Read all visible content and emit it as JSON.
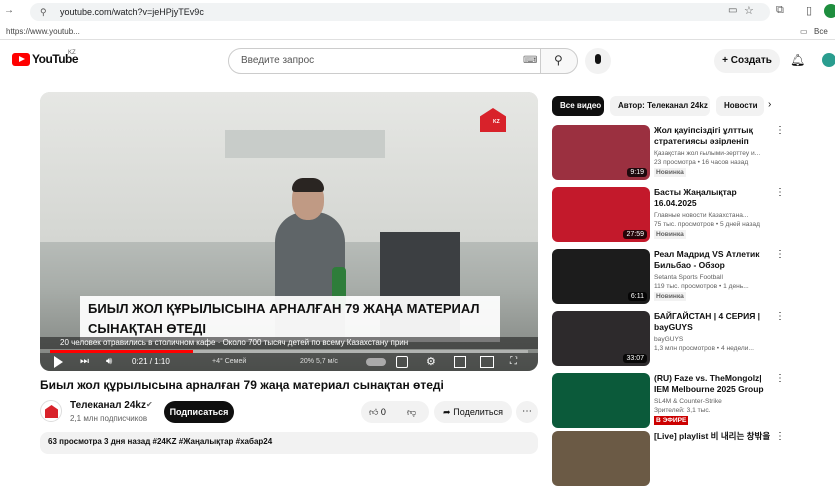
{
  "browser": {
    "url": "youtube.com/watch?v=jeHPjyTEv9c",
    "bookmark": "https://www.youtub...",
    "bookmarks_all": "Все за"
  },
  "header": {
    "logo": "YouTube",
    "region": "KZ",
    "search_placeholder": "Введите запрос",
    "create_label": "Создать"
  },
  "player": {
    "channel_logo": "KZ",
    "lower_third": "БИЫЛ ЖОЛ ҚҰРЫЛЫСЫНА АРНАЛҒАН 79 ЖАҢА МАТЕРИАЛ СЫНАҚТАН ӨТЕДІ",
    "ticker": "20 человек отравились в столичном кафе   ·   Около 700 тысяч детей по всему Казахстану прин",
    "weather_left": "+4°  Семей",
    "weather_right": "20%  5,7 м/с",
    "time": "0:21 / 1:10",
    "progress": 0.3
  },
  "video": {
    "title": "Биыл жол құрылысына арналған 79 жаңа материал сынақтан өтеді",
    "channel": "Телеканал 24kz",
    "subscribers": "2,1 млн подписчиков",
    "subscribe_label": "Подписаться",
    "likes": "0",
    "share_label": "Поделиться",
    "description": "63 просмотра  3 дня назад  #24KZ #Жаңалықтар #хабар24"
  },
  "chips": [
    "Все видео",
    "Автор: Телеканал 24kz",
    "Новости"
  ],
  "recommendations": [
    {
      "title": "Жол қауіпсіздігі ұлттық стратегиясы әзірленіп жатыр",
      "channel": "Қазақстан жол ғылыми-зерттеу и...",
      "meta": "23 просмотра • 16 часов назад",
      "badge": "Новинка",
      "duration": "9:19",
      "thumb": "#9b3040"
    },
    {
      "title": "Басты Жаңалықтар 16.04.2025",
      "channel": "Главные новости Казахстана...",
      "meta": "75 тыс. просмотров • 5 дней назад",
      "badge": "Новинка",
      "duration": "27:59",
      "thumb": "#c3192b"
    },
    {
      "title": "Реал Мадрид VS Атлетик Бильбао - Обзор",
      "channel": "Setanta Sports Football",
      "meta": "119 тыс. просмотров • 1 день...",
      "badge": "Новинка",
      "duration": "6:11",
      "thumb": "#1c1c1c"
    },
    {
      "title": "БАЙГАЙСТАН | 4 СЕРИЯ | bayGUYS",
      "channel": "bayGUYS",
      "meta": "1,3 млн просмотров • 4 недели...",
      "badge": "",
      "duration": "33:07",
      "thumb": "#2d2a2c"
    },
    {
      "title": "(RU) Faze vs. TheMongolz| IEM Melbourne 2025 Group Stage |...",
      "channel": "SL4M & Counter-Strike",
      "meta": "Зрителей: 3,1 тыс.",
      "badge": "В ЭФИРЕ",
      "duration": "",
      "thumb": "#0b5a3a"
    },
    {
      "title": "[Live] playlist 비 내리는 창밖을",
      "channel": "",
      "meta": "",
      "badge": "",
      "duration": "",
      "thumb": "#6b5a45"
    }
  ]
}
